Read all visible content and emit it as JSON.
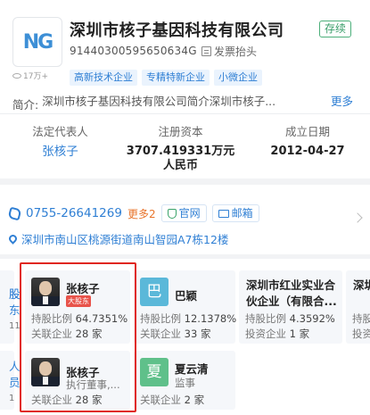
{
  "company": {
    "logo_text": "NG",
    "name": "深圳市核子基因科技有限公司",
    "status": "存续",
    "credit_code": "91440300595650634G",
    "invoice_label": "发票抬头",
    "visits": "17万+",
    "tags": [
      "高新技术企业",
      "专精特新企业",
      "小微企业"
    ],
    "intro_label": "简介:",
    "intro_text": "深圳市核子基因科技有限公司简介深圳市核子...",
    "intro_more": "更多"
  },
  "info": {
    "legal_rep_label": "法定代表人",
    "legal_rep": "张核子",
    "capital_label": "注册资本",
    "capital_line1": "3707.419331万元",
    "capital_line2": "人民币",
    "date_label": "成立日期",
    "date": "2012-04-27"
  },
  "contact": {
    "phone": "0755-26641269",
    "more_phones": "更多2",
    "website": "官网",
    "email": "邮箱",
    "address": "深圳市南山区桃源街道南山智园A7栋12楼"
  },
  "edge_left": {
    "top_lines": [
      "股",
      "东",
      "11"
    ],
    "bottom_lines": [
      "人",
      "员",
      "1"
    ]
  },
  "shareholders": [
    {
      "name": "张核子",
      "badge": "大股东",
      "line1_label": "持股比例",
      "line1_value": "64.7351%",
      "line2_label": "关联企业",
      "line2_value": "28 家"
    },
    {
      "avatar_char": "巴",
      "avatar_color": "#5bb8d9",
      "name": "巴颖",
      "line1_label": "持股比例",
      "line1_value": "12.1378%",
      "line2_label": "关联企业",
      "line2_value": "33 家"
    },
    {
      "name": "深圳市红业实业合伙企业（有限合...",
      "line1_label": "持股比例",
      "line1_value": "4.3592%",
      "line2_label": "投资企业",
      "line2_value": "1 家"
    },
    {
      "name": "深圳",
      "line1_label": "持股",
      "line2_label": "投资"
    }
  ],
  "staff": [
    {
      "name": "张核子",
      "line1_value": "执行董事,...",
      "line2_label": "关联企业",
      "line2_value": "28 家"
    },
    {
      "avatar_char": "夏",
      "avatar_color": "#5fc08a",
      "name": "夏云清",
      "line1_value": "监事",
      "line2_label": "关联企业",
      "line2_value": "2 家"
    }
  ]
}
